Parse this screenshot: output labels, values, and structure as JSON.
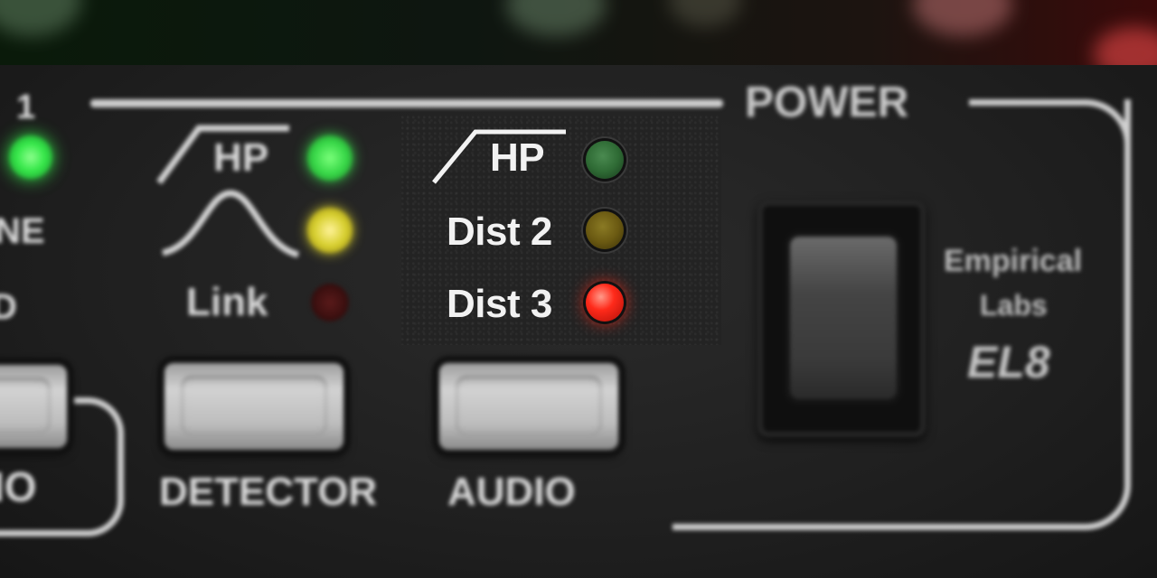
{
  "panel": {
    "channel_number": "1",
    "left_label_partial_1": "NE",
    "left_label_partial_2": "D",
    "left_button_label_partial": "IO",
    "link_label": "Link",
    "hp_symbol_label": "HP",
    "detector_label": "DETECTOR",
    "audio_label": "AUDIO",
    "power_label": "POWER",
    "brand_line_1": "Empirical",
    "brand_line_2": "Labs",
    "model": "EL8"
  },
  "overlay": {
    "items": [
      {
        "label": "HP",
        "led_color": "#2f6b35",
        "state": "off"
      },
      {
        "label": "Dist 2",
        "led_color": "#6b5a12",
        "state": "off"
      },
      {
        "label": "Dist 3",
        "led_color": "#ff2a1a",
        "state": "on"
      }
    ]
  },
  "leds": {
    "green": "#36e84a",
    "yellow": "#d7cf2e",
    "red_dim": "#3a0f0f"
  }
}
